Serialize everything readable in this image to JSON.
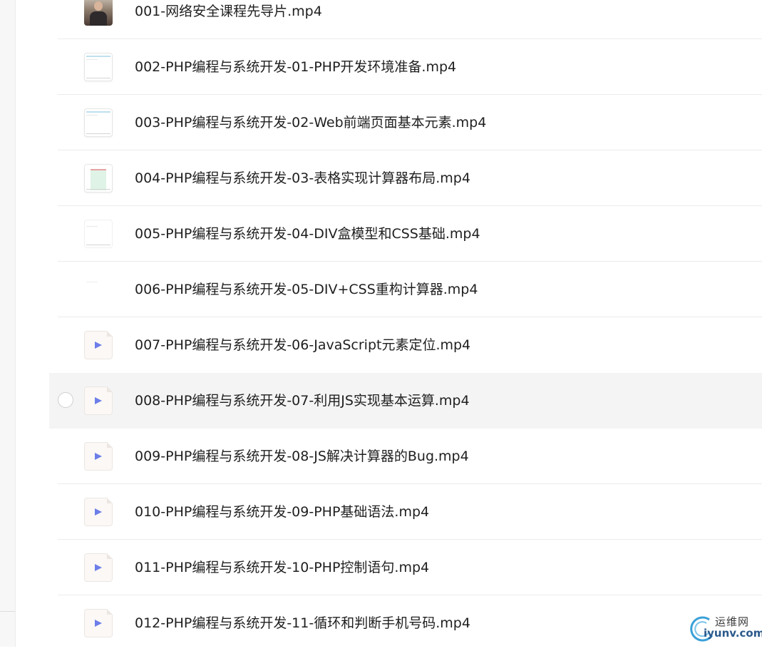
{
  "files": [
    {
      "name": "001-网络安全课程先导片.mp4",
      "thumb": "photo-thumbnail"
    },
    {
      "name": "002-PHP编程与系统开发-01-PHP开发环境准备.mp4",
      "thumb": "screen-thumbnail"
    },
    {
      "name": "003-PHP编程与系统开发-02-Web前端页面基本元素.mp4",
      "thumb": "screen-thumbnail"
    },
    {
      "name": "004-PHP编程与系统开发-03-表格实现计算器布局.mp4",
      "thumb": "screen-thumbnail"
    },
    {
      "name": "005-PHP编程与系统开发-04-DIV盒模型和CSS基础.mp4",
      "thumb": "screen-thumbnail"
    },
    {
      "name": "006-PHP编程与系统开发-05-DIV+CSS重构计算器.mp4",
      "thumb": "screen-thumbnail"
    },
    {
      "name": "007-PHP编程与系统开发-06-JavaScript元素定位.mp4",
      "thumb": "video-file-icon"
    },
    {
      "name": "008-PHP编程与系统开发-07-利用JS实现基本运算.mp4",
      "thumb": "video-file-icon",
      "hovered": true
    },
    {
      "name": "009-PHP编程与系统开发-08-JS解决计算器的Bug.mp4",
      "thumb": "video-file-icon"
    },
    {
      "name": "010-PHP编程与系统开发-09-PHP基础语法.mp4",
      "thumb": "video-file-icon"
    },
    {
      "name": "011-PHP编程与系统开发-10-PHP控制语句.mp4",
      "thumb": "video-file-icon"
    },
    {
      "name": "012-PHP编程与系统开发-11-循环和判断手机号码.mp4",
      "thumb": "video-file-icon"
    }
  ],
  "watermark": {
    "text_cn": "运维网",
    "text_en": "iyunv.com"
  },
  "colors": {
    "hover_row": "#f4f4f5",
    "play_icon": "#6c7ee8",
    "text": "#1f1f1f",
    "watermark_brand": "#2b5a8c"
  }
}
